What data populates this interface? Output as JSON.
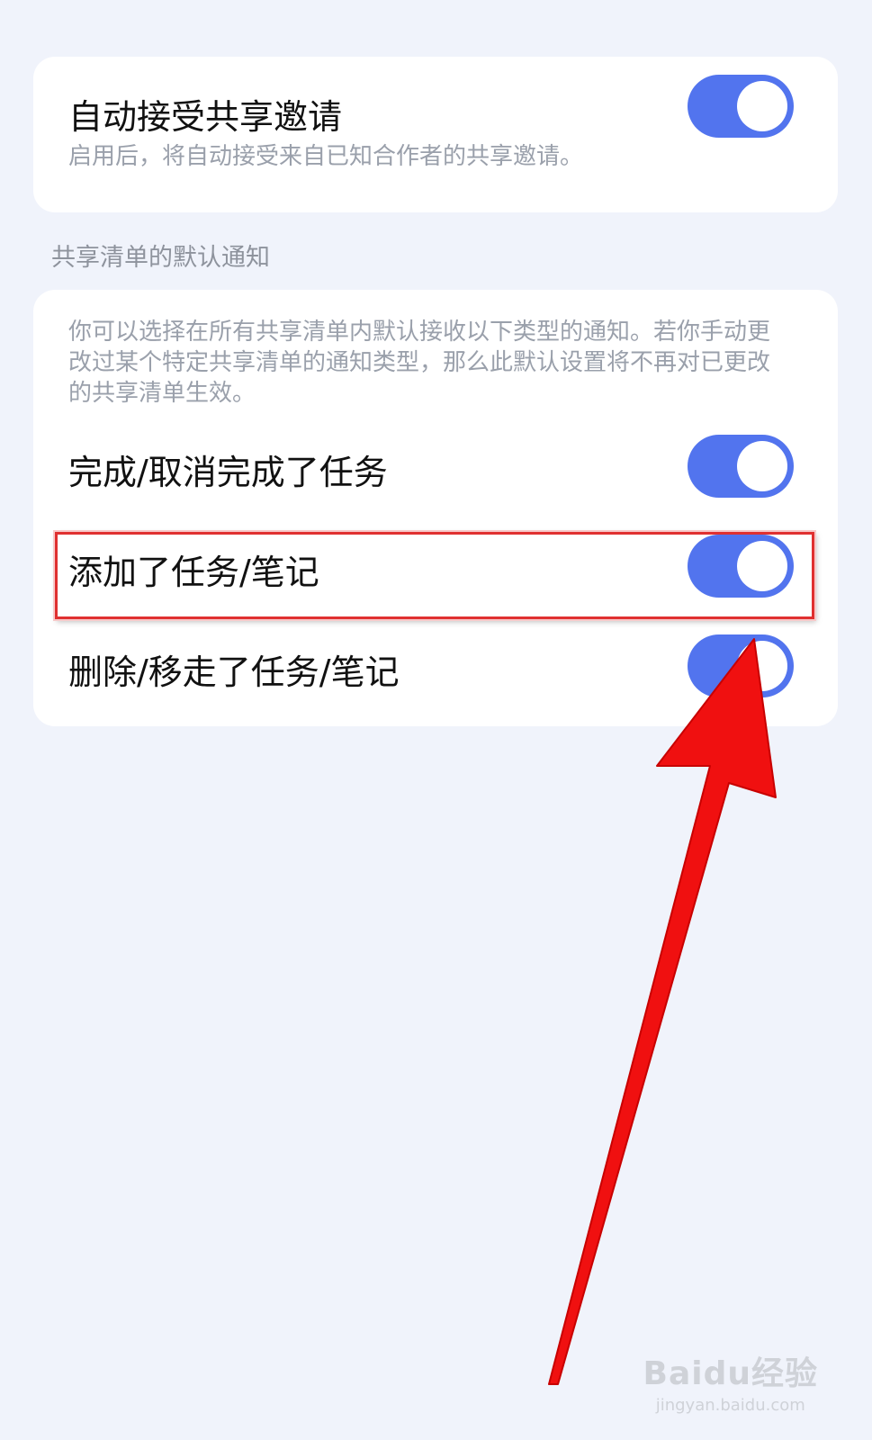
{
  "auto_accept": {
    "title": "自动接受共享邀请",
    "description": "启用后，将自动接受来自已知合作者的共享邀请。",
    "enabled": true
  },
  "section_label": "共享清单的默认通知",
  "notifications": {
    "description": "你可以选择在所有共享清单内默认接收以下类型的通知。若你手动更改过某个特定共享清单的通知类型，那么此默认设置将不再对已更改的共享清单生效。",
    "items": [
      {
        "label": "完成/取消完成了任务",
        "enabled": true
      },
      {
        "label": "添加了任务/笔记",
        "enabled": true
      },
      {
        "label": "删除/移走了任务/笔记",
        "enabled": true
      }
    ]
  },
  "watermark": {
    "main": "Baidu经验",
    "sub": "jingyan.baidu.com"
  },
  "colors": {
    "toggle_on": "#5274ee",
    "highlight": "#e03030",
    "arrow": "#f01010"
  }
}
